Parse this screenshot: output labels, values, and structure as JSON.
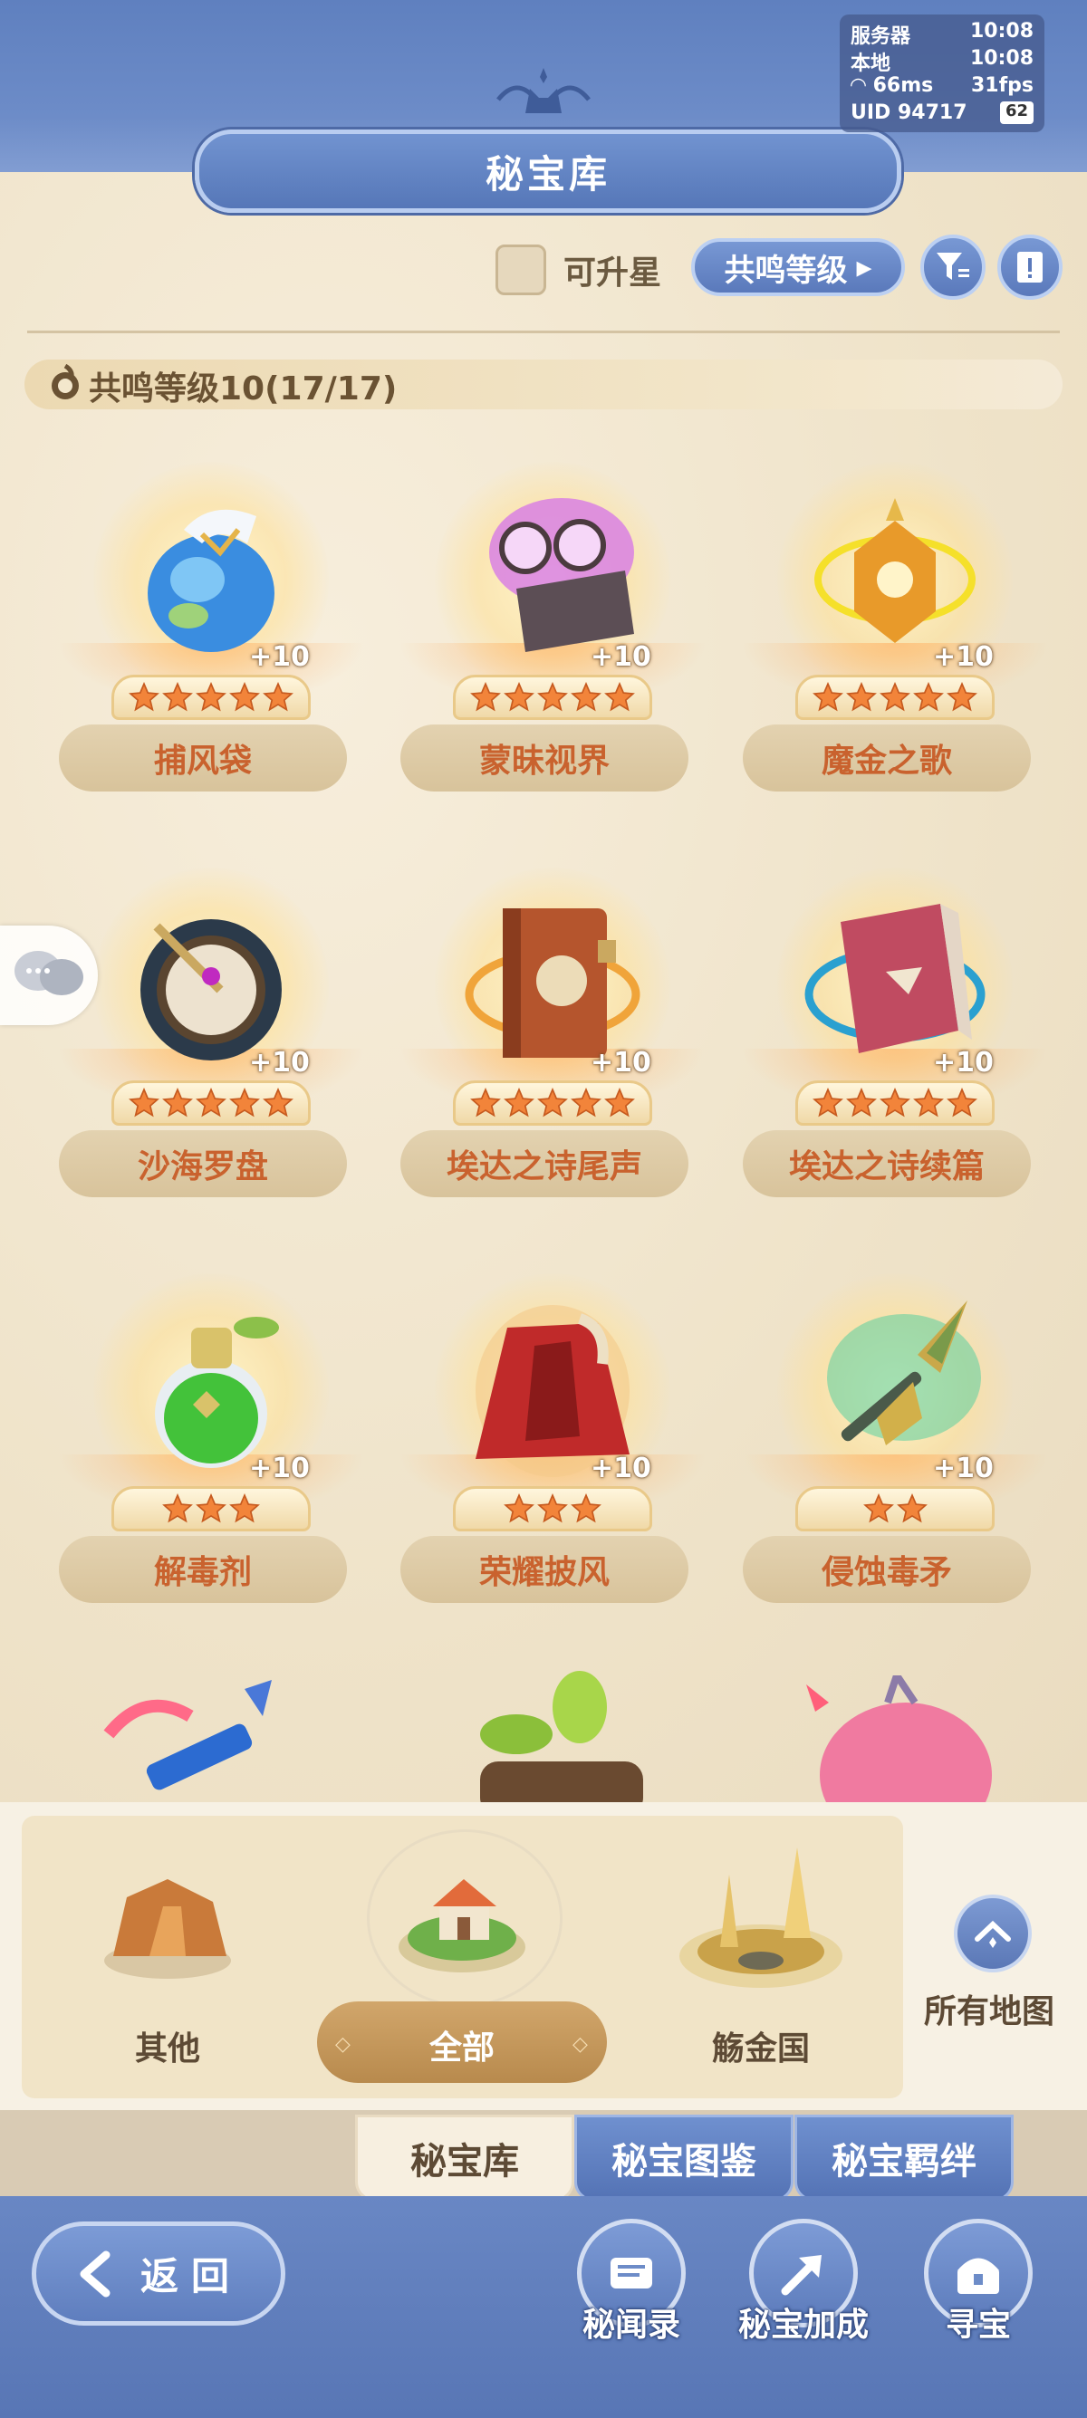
{
  "status": {
    "server_label": "服务器",
    "server_time": "10:08",
    "local_label": "本地",
    "local_time": "10:08",
    "ping": "66ms",
    "fps": "31fps",
    "uid": "UID 94717",
    "battery": "62"
  },
  "title": "秘宝库",
  "toolbar": {
    "upgradable_label": "可升星",
    "sort_label": "共鸣等级"
  },
  "group": {
    "title": "共鸣等级10(17/17)"
  },
  "colors": {
    "primary_blue": "#6181c2",
    "parchment": "#f4ead7",
    "name_orange": "#c9622e"
  },
  "items": [
    {
      "name": "捕风袋",
      "level": "+10",
      "stars": 5,
      "icon": "wind-bag-icon"
    },
    {
      "name": "蒙昧视界",
      "level": "+10",
      "stars": 5,
      "icon": "goggles-icon"
    },
    {
      "name": "魔金之歌",
      "level": "+10",
      "stars": 5,
      "icon": "golden-lantern-icon"
    },
    {
      "name": "沙海罗盘",
      "level": "+10",
      "stars": 5,
      "icon": "compass-icon"
    },
    {
      "name": "埃达之诗尾声",
      "level": "+10",
      "stars": 5,
      "icon": "orange-book-icon"
    },
    {
      "name": "埃达之诗续篇",
      "level": "+10",
      "stars": 5,
      "icon": "red-book-icon"
    },
    {
      "name": "解毒剂",
      "level": "+10",
      "stars": 3,
      "icon": "potion-icon"
    },
    {
      "name": "荣耀披风",
      "level": "+10",
      "stars": 3,
      "icon": "cape-icon"
    },
    {
      "name": "侵蚀毒矛",
      "level": "+10",
      "stars": 2,
      "icon": "spear-icon"
    }
  ],
  "regions": [
    {
      "label": "其他",
      "icon": "canyon-icon"
    },
    {
      "label": "全部",
      "icon": "island-house-icon"
    },
    {
      "label": "觞金国",
      "icon": "golden-city-icon"
    }
  ],
  "map_button_label": "所有地图",
  "tabs": [
    "秘宝库",
    "秘宝图鉴",
    "秘宝羁绊"
  ],
  "back_label": "返回",
  "footer_buttons": [
    "秘闻录",
    "秘宝加成",
    "寻宝"
  ]
}
